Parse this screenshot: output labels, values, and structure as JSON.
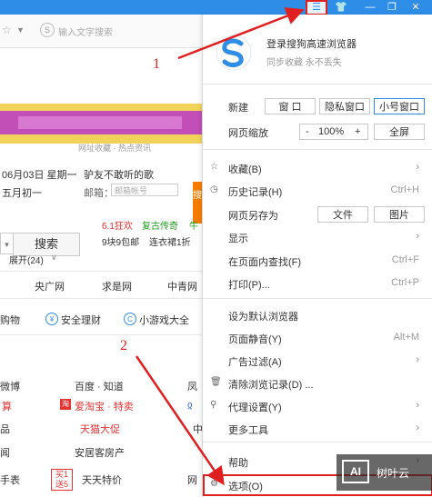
{
  "titlebar": {
    "menu_icon": "☰",
    "skin_icon": "👕",
    "min_icon": "—",
    "max_icon": "❐",
    "close_icon": "✕"
  },
  "addressbar": {
    "search_placeholder": "输入文字搜索"
  },
  "page": {
    "tabs_hint": "网址收藏 · 热点资讯",
    "date": "06月03日 星期一",
    "lunar": "五月初一",
    "notice": "驴友不敢听的歌",
    "mail_label": "邮箱：",
    "mail_placeholder": "邮箱帐号",
    "side_text": "搜",
    "search_button": "搜索",
    "promo1": "6.1狂欢",
    "promo2": "复古传奇",
    "promo3": "牛",
    "promo4": "9块9包邮",
    "promo5": "连衣裙1折",
    "expand": "展开(24)",
    "nav1": "央广网",
    "nav2": "求是网",
    "nav3": "中青网",
    "tool1": "购物",
    "tool2": "安全理财",
    "tool3": "小游戏大全",
    "site1": "微博",
    "site2": "百度 · 知道",
    "site3": "凤",
    "site4": "算",
    "site5": "爱淘宝 · 特卖",
    "site6": "品",
    "site7": "天猫大促",
    "site8": "中",
    "site9": "闻",
    "site10": "安居客房产",
    "site11": "手表",
    "badge": "买1送5",
    "site12": "天天特价",
    "site13": "网"
  },
  "menu": {
    "login": "登录搜狗高速浏览器",
    "sync": "同步收藏 永不丢失",
    "new_label": "新建",
    "new_window": "窗 口",
    "private_window": "隐私窗口",
    "small_window": "小号窗口",
    "zoom_label": "网页缩放",
    "zoom_minus": "-",
    "zoom_value": "100%",
    "zoom_plus": "+",
    "fullscreen": "全屏",
    "favorites": "收藏(B)",
    "history": "历史记录(H)",
    "history_shortcut": "Ctrl+H",
    "save_as": "网页另存为",
    "save_file": "文件",
    "save_image": "图片",
    "show": "显示",
    "find": "在页面内查找(F)",
    "find_shortcut": "Ctrl+F",
    "print": "打印(P)...",
    "print_shortcut": "Ctrl+P",
    "set_default": "设为默认浏览器",
    "mute": "页面静音(Y)",
    "mute_shortcut": "Alt+M",
    "adfilter": "广告过滤(A)",
    "clear": "清除浏览记录(D) ...",
    "proxy": "代理设置(Y)",
    "more_tools": "更多工具",
    "help": "帮助",
    "options": "选项(O)"
  },
  "annotations": {
    "label1": "1",
    "label2": "2",
    "watermark_icon": "AI",
    "watermark_text": "树叶云"
  },
  "colors": {
    "titlebar": "#2e8de6",
    "highlight": "#e02020"
  }
}
